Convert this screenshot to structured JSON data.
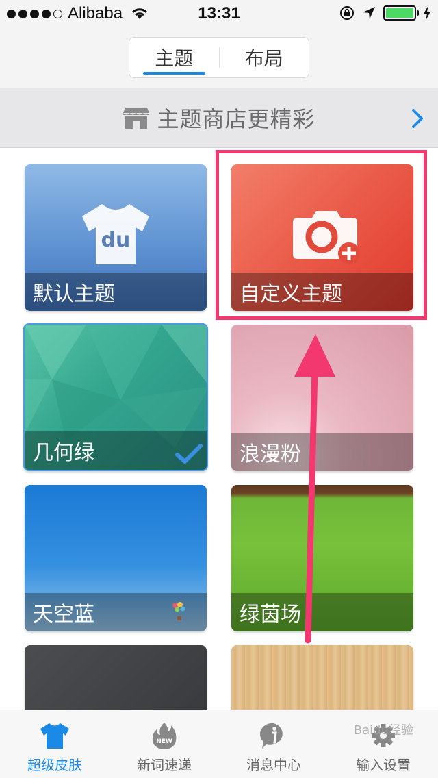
{
  "status_bar": {
    "carrier": "Alibaba",
    "time": "13:31",
    "signal_bars_filled": 4,
    "signal_bars_total": 5,
    "battery_color": "#4cd964"
  },
  "header": {
    "tabs": [
      {
        "label": "主题",
        "active": true
      },
      {
        "label": "布局",
        "active": false
      }
    ],
    "accent_color": "#1a8ae6"
  },
  "store_banner": {
    "label": "主题商店更精彩",
    "icon": "store-icon",
    "arrow_icon": "chevron-right-icon"
  },
  "themes": [
    {
      "name": "默认主题",
      "icon": "tshirt-du-icon"
    },
    {
      "name": "自定义主题",
      "icon": "camera-add-icon",
      "highlighted": true
    },
    {
      "name": "几何绿",
      "selected": true
    },
    {
      "name": "浪漫粉"
    },
    {
      "name": "天空蓝"
    },
    {
      "name": "绿茵场"
    },
    {
      "name": ""
    },
    {
      "name": ""
    }
  ],
  "tshirt_text": "du",
  "annotation": {
    "highlight_color": "#f2386f"
  },
  "tabbar": {
    "items": [
      {
        "label": "超级皮肤",
        "icon": "tshirt-icon",
        "active": true
      },
      {
        "label": "新词速递",
        "icon": "new-fire-icon",
        "active": false
      },
      {
        "label": "消息中心",
        "icon": "info-icon",
        "active": false
      },
      {
        "label": "输入设置",
        "icon": "gear-icon",
        "active": false
      }
    ],
    "new_badge_text": "NEW"
  },
  "watermark": "Baidu经验"
}
